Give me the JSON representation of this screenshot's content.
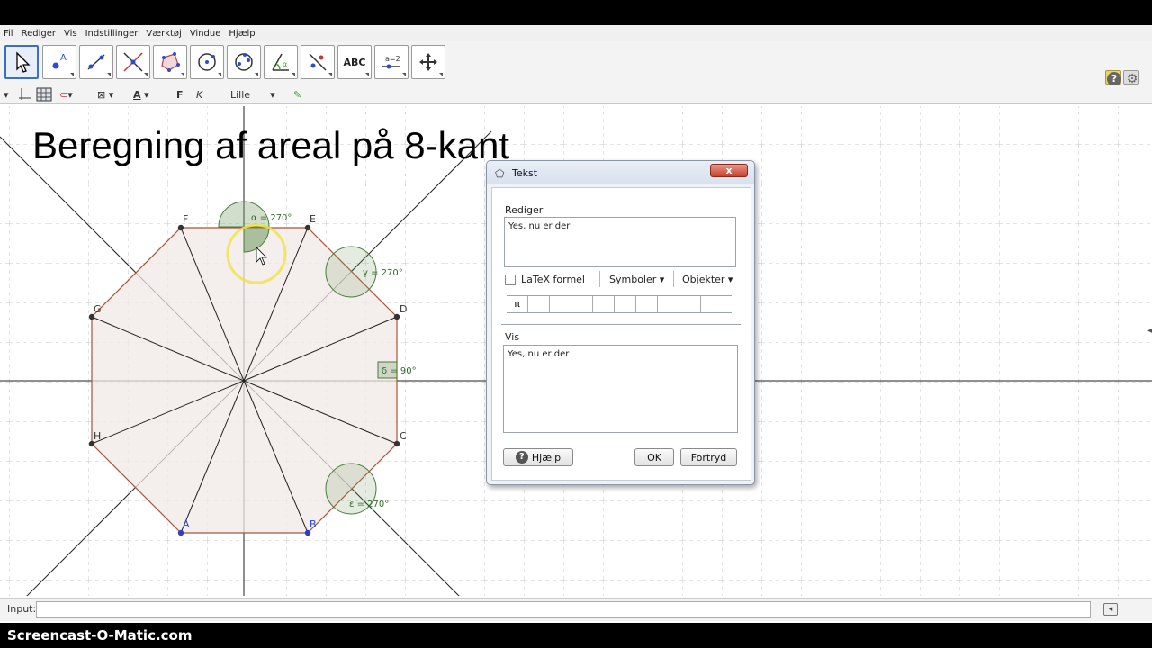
{
  "menu": [
    "Fil",
    "Rediger",
    "Vis",
    "Indstillinger",
    "Værktøj",
    "Vindue",
    "Hjælp"
  ],
  "tools": [
    {
      "name": "move-tool-icon",
      "selected": true
    },
    {
      "name": "point-tool-icon"
    },
    {
      "name": "line-tool-icon"
    },
    {
      "name": "perpendicular-tool-icon"
    },
    {
      "name": "polygon-tool-icon"
    },
    {
      "name": "circle-tool-icon"
    },
    {
      "name": "ellipse-tool-icon"
    },
    {
      "name": "angle-tool-icon"
    },
    {
      "name": "reflect-tool-icon"
    },
    {
      "name": "text-tool-icon",
      "label": "ABC"
    },
    {
      "name": "slider-tool-icon",
      "label": "a=2"
    },
    {
      "name": "move-view-tool-icon"
    }
  ],
  "stylebar": {
    "font_bold": "F",
    "font_italic": "K",
    "size": "Lille",
    "text_color": "A"
  },
  "title": "Beregning af areal på 8-kant",
  "points": [
    "A",
    "B",
    "C",
    "D",
    "E",
    "F",
    "G",
    "H"
  ],
  "angles": {
    "alpha": "α = 270°",
    "gamma": "γ = 270°",
    "delta": "δ = 90°",
    "epsilon": "ε = 270°"
  },
  "dialog": {
    "title": "Tekst",
    "edit_label": "Rediger",
    "edit_text": "Yes, nu er der",
    "latex_label": "LaTeX formel",
    "symbols": "Symboler",
    "objects": "Objekter",
    "pi": "π",
    "preview_label": "Vis",
    "preview_text": "Yes, nu er der",
    "help": "Hjælp",
    "ok": "OK",
    "cancel": "Fortryd",
    "close": "x"
  },
  "input": {
    "label": "Input:",
    "value": ""
  },
  "watermark": "Screencast-O-Matic.com",
  "colors": {
    "selection": "#3a6ec8",
    "polygon_fill": "#f0e8e6",
    "polygon_edge": "#a8553a",
    "angle_fill": "#7aa06a"
  }
}
